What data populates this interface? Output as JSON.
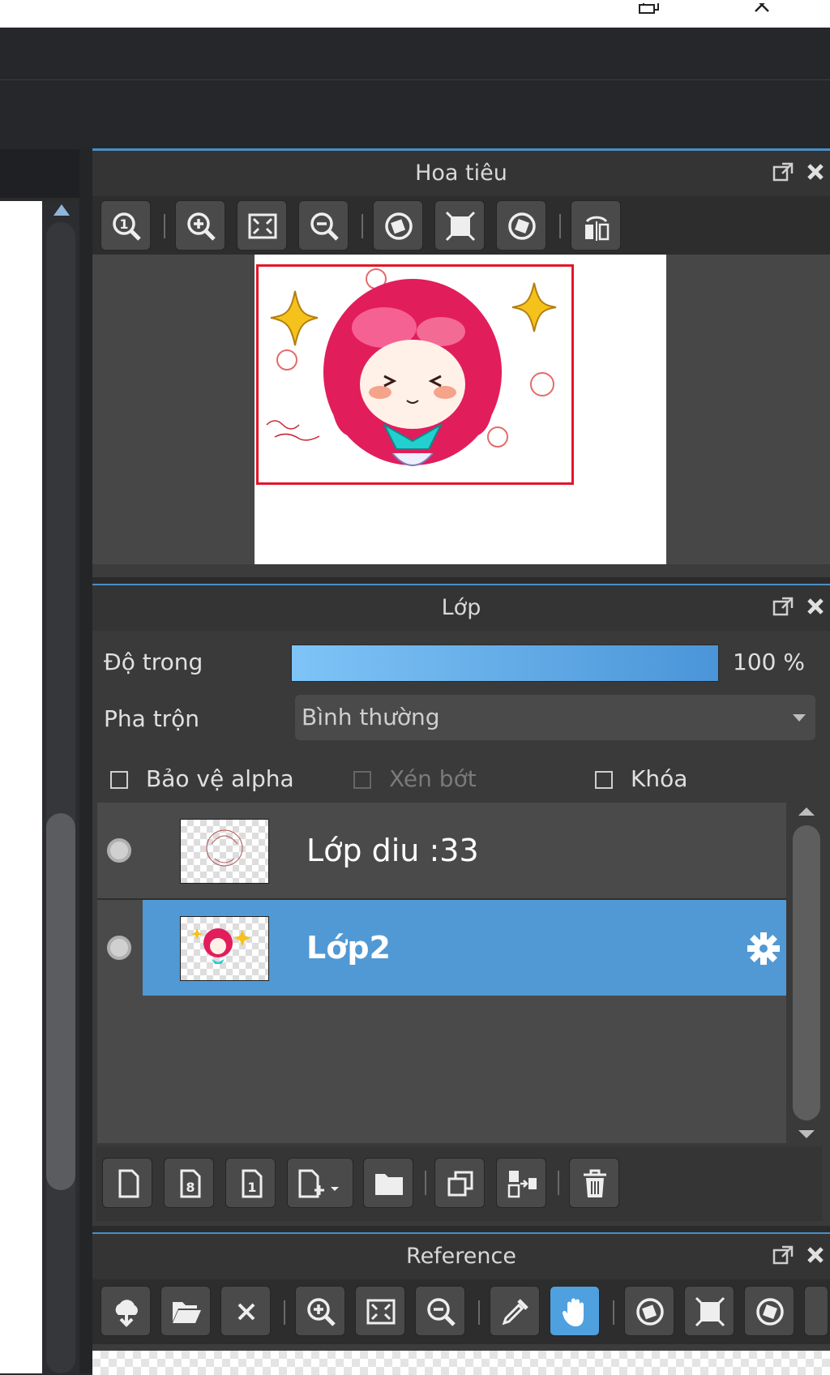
{
  "navigator": {
    "title": "Hoa tiêu",
    "tools": [
      "zoom-actual-icon",
      "zoom-in-icon",
      "fit-window-icon",
      "zoom-out-icon",
      "rotate-left-icon",
      "reset-rotation-icon",
      "rotate-right-icon",
      "flip-horizontal-icon"
    ]
  },
  "layers": {
    "title": "Lớp",
    "opacity_label": "Độ trong",
    "opacity_value": "100 %",
    "opacity_fraction": 1.0,
    "blend_label": "Pha trộn",
    "blend_value": "Bình thường",
    "protect_alpha": "Bảo vệ alpha",
    "clipping": "Xén bớt",
    "lock": "Khóa",
    "items": [
      {
        "name": "Lớp diu :33",
        "selected": false
      },
      {
        "name": "Lớp2",
        "selected": true
      }
    ],
    "accent": "#5199d4"
  },
  "reference": {
    "title": "Reference"
  }
}
